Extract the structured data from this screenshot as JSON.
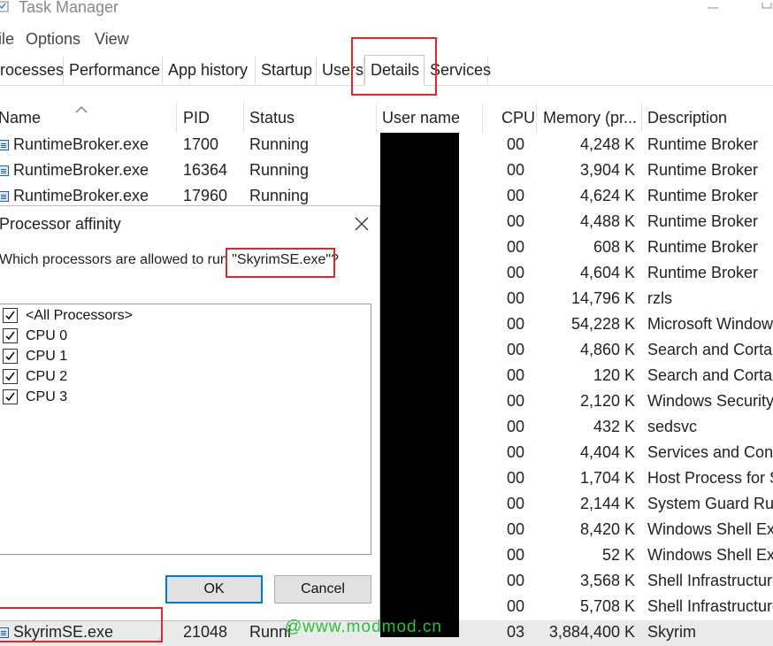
{
  "window": {
    "title": "Task Manager"
  },
  "menu": [
    "ile",
    "Options",
    "View"
  ],
  "tabs": [
    "rocesses",
    "Performance",
    "App history",
    "Startup",
    "Users",
    "Details",
    "Services"
  ],
  "active_tab": "Details",
  "columns": {
    "name": "Name",
    "pid": "PID",
    "status": "Status",
    "user": "User name",
    "cpu": "CPU",
    "memory": "Memory (pr...",
    "description": "Description"
  },
  "rows": [
    {
      "name": "RuntimeBroker.exe",
      "pid": "1700",
      "status": "Running",
      "cpu": "00",
      "memory": "4,248 K",
      "description": "Runtime Broker"
    },
    {
      "name": "RuntimeBroker.exe",
      "pid": "16364",
      "status": "Running",
      "cpu": "00",
      "memory": "3,904 K",
      "description": "Runtime Broker"
    },
    {
      "name": "RuntimeBroker.exe",
      "pid": "17960",
      "status": "Running",
      "cpu": "00",
      "memory": "4,624 K",
      "description": "Runtime Broker"
    },
    {
      "cpu": "00",
      "memory": "4,488 K",
      "description": "Runtime Broker"
    },
    {
      "cpu": "00",
      "memory": "608 K",
      "description": "Runtime Broker"
    },
    {
      "cpu": "00",
      "memory": "4,604 K",
      "description": "Runtime Broker"
    },
    {
      "cpu": "00",
      "memory": "14,796 K",
      "description": "rzls"
    },
    {
      "cpu": "00",
      "memory": "54,228 K",
      "description": "Microsoft Window"
    },
    {
      "cpu": "00",
      "memory": "4,860 K",
      "description": "Search and Cortar"
    },
    {
      "cpu": "00",
      "memory": "120 K",
      "description": "Search and Cortar"
    },
    {
      "cpu": "00",
      "memory": "2,120 K",
      "description": "Windows Security"
    },
    {
      "cpu": "00",
      "memory": "432 K",
      "description": "sedsvc"
    },
    {
      "cpu": "00",
      "memory": "4,404 K",
      "description": "Services and Cont"
    },
    {
      "cpu": "00",
      "memory": "1,704 K",
      "description": "Host Process for S"
    },
    {
      "cpu": "00",
      "memory": "2,144 K",
      "description": "System Guard Run"
    },
    {
      "cpu": "00",
      "memory": "8,420 K",
      "description": "Windows Shell Exp"
    },
    {
      "cpu": "00",
      "memory": "52 K",
      "description": "Windows Shell Exp"
    },
    {
      "cpu": "00",
      "memory": "3,568 K",
      "description": "Shell Infrastructure"
    },
    {
      "cpu": "00",
      "memory": "5,708 K",
      "description": "Shell Infrastructure"
    },
    {
      "name": "SkyrimSE.exe",
      "pid": "21048",
      "status": "Runni",
      "cpu": "03",
      "memory": "3,884,400 K",
      "description": "Skyrim"
    }
  ],
  "dialog": {
    "title": "Processor affinity",
    "question_prefix": "Which processors are allowed to run ",
    "question_target": "\"SkyrimSE.exe\"?",
    "options": [
      {
        "label": "<All Processors>",
        "checked": true
      },
      {
        "label": "CPU 0",
        "checked": true
      },
      {
        "label": "CPU 1",
        "checked": true
      },
      {
        "label": "CPU 2",
        "checked": true
      },
      {
        "label": "CPU 3",
        "checked": true
      }
    ],
    "ok_label": "OK",
    "cancel_label": "Cancel"
  },
  "watermark": "@www.modmod.cn",
  "colors": {
    "highlight_red": "#e0262e",
    "accent_blue": "#0078d7",
    "watermark_green": "#27c13a"
  }
}
